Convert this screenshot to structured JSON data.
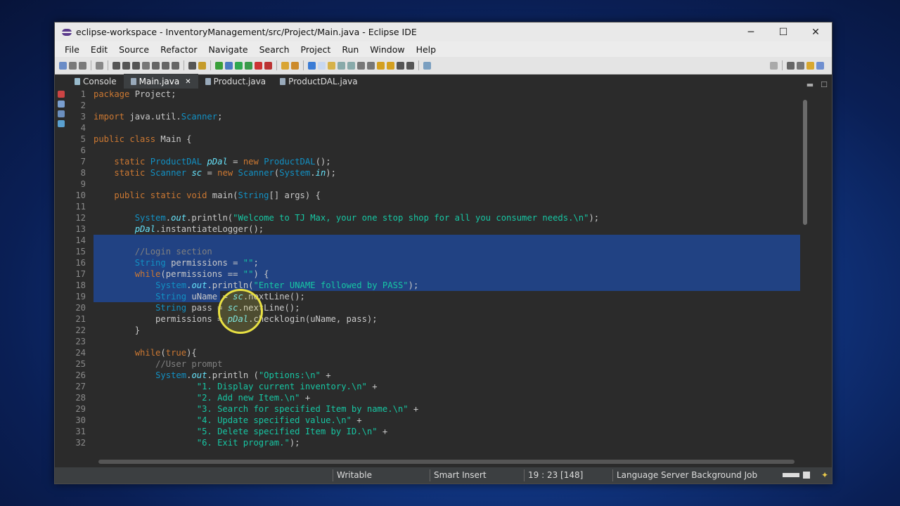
{
  "window": {
    "title": "eclipse-workspace - InventoryManagement/src/Project/Main.java - Eclipse IDE",
    "minimize_glyph": "─",
    "maximize_glyph": "☐",
    "close_glyph": "✕"
  },
  "menu": [
    "File",
    "Edit",
    "Source",
    "Refactor",
    "Navigate",
    "Search",
    "Project",
    "Run",
    "Window",
    "Help"
  ],
  "tabs": [
    {
      "label": "Console",
      "icon": "console-icon"
    },
    {
      "label": "Main.java",
      "icon": "java-file-icon",
      "active": true,
      "close": "✕"
    },
    {
      "label": "Product.java",
      "icon": "java-file-icon"
    },
    {
      "label": "ProductDAL.java",
      "icon": "java-file-icon"
    }
  ],
  "code_lines": [
    {
      "n": "1",
      "text": "package Project;"
    },
    {
      "n": "2",
      "text": ""
    },
    {
      "n": "3",
      "text": "import java.util.Scanner;"
    },
    {
      "n": "4",
      "text": ""
    },
    {
      "n": "5",
      "text": "public class Main {"
    },
    {
      "n": "6",
      "text": ""
    },
    {
      "n": "7",
      "text": "    static ProductDAL pDal = new ProductDAL();"
    },
    {
      "n": "8",
      "text": "    static Scanner sc = new Scanner(System.in);"
    },
    {
      "n": "9",
      "text": ""
    },
    {
      "n": "10",
      "text": "    public static void main(String[] args) {"
    },
    {
      "n": "11",
      "text": ""
    },
    {
      "n": "12",
      "text": "        System.out.println(\"Welcome to TJ Max, your one stop shop for all you consumer needs.\\n\");"
    },
    {
      "n": "13",
      "text": "        pDal.instantiateLogger();"
    },
    {
      "n": "14",
      "text": ""
    },
    {
      "n": "15",
      "text": "        //Login section"
    },
    {
      "n": "16",
      "text": "        String permissions = \"\";"
    },
    {
      "n": "17",
      "text": "        while(permissions == \"\") {"
    },
    {
      "n": "18",
      "text": "            System.out.println(\"Enter UNAME followed by PASS\");"
    },
    {
      "n": "19",
      "text": "            String uName = sc.nextLine();"
    },
    {
      "n": "20",
      "text": "            String pass = sc.nextLine();"
    },
    {
      "n": "21",
      "text": "            permissions = pDal.checklogin(uName, pass);"
    },
    {
      "n": "22",
      "text": "        }"
    },
    {
      "n": "23",
      "text": ""
    },
    {
      "n": "24",
      "text": "        while(true){"
    },
    {
      "n": "25",
      "text": "            //User prompt"
    },
    {
      "n": "26",
      "text": "            System.out.println (\"Options:\\n\" +"
    },
    {
      "n": "27",
      "text": "                    \"1. Display current inventory.\\n\" +"
    },
    {
      "n": "28",
      "text": "                    \"2. Add new Item.\\n\" +"
    },
    {
      "n": "29",
      "text": "                    \"3. Search for specified Item by name.\\n\" +"
    },
    {
      "n": "30",
      "text": "                    \"4. Update specified value.\\n\" +"
    },
    {
      "n": "31",
      "text": "                    \"5. Delete specified Item by ID.\\n\" +"
    },
    {
      "n": "32",
      "text": "                    \"6. Exit program.\");"
    }
  ],
  "status": {
    "writable": "Writable",
    "insert_mode": "Smart Insert",
    "position": "19 : 23 [148]",
    "job": "Language Server Background Job"
  }
}
